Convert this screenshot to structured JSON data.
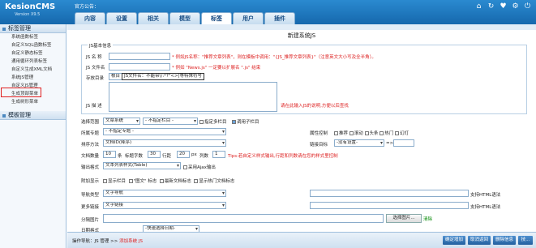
{
  "app": {
    "logo": "KesionCMS",
    "version": "Version X9.5",
    "notice": "官方公告："
  },
  "tabs": [
    {
      "label": "内容"
    },
    {
      "label": "设置"
    },
    {
      "label": "相关"
    },
    {
      "label": "模型"
    },
    {
      "label": "标签"
    },
    {
      "label": "用户"
    },
    {
      "label": "插件"
    }
  ],
  "active_tab": "标签",
  "sidebar": {
    "section1": "标签管理",
    "items": [
      "系统函数标签",
      "自定义SQL函数标签",
      "自定义静态标签",
      "通用循环列表标签",
      "自定义生成XML文档",
      "系统JS管理",
      "自定义JS管理",
      "生成顶部菜单",
      "生成树形菜单"
    ],
    "highlighted": "系统JS管理",
    "section2": "模板管理"
  },
  "page": {
    "title": "新建系统JS",
    "legend": "JS基本信息"
  },
  "form": {
    "js_name_label": "JS 名 称",
    "js_name_hint": "* 例如JS名称：\"推荐文章列表\"，则在模板中调用：\"{JS_推荐文章列表}\"（注意英文大小写及全半角）。",
    "js_file_label": "JS 文件名",
    "js_file_hint": "* 例如 \"News.js\" 一定要以扩展名 \".js\" 结束",
    "dir_label": "存放目录",
    "dir_value": "根目",
    "dir_tooltip": "JS文件名：不能带\\/:*?\"<>|等特殊符号",
    "desc_label": "JS 描 述",
    "desc_hint": "请在此输入JS的说明,方便以后查找",
    "column_label": "选择范围",
    "column_value": "文章系统",
    "column_sub": "- 不指定栏目 -",
    "cb_multi": "指定多栏目",
    "cb_sub": "调用子栏目",
    "special_label": "所属专题",
    "special_value": "- 不指定专题 -",
    "attr_label": "属性控制",
    "attrs": [
      "推荐",
      "滚动",
      "头条",
      "热门",
      "幻灯"
    ],
    "order_label": "排序方法",
    "order_value": "文档ID(降序)",
    "target_label": "链接目标",
    "target_value": "-没有设置-",
    "count_label": "文档数量",
    "count_value": "10",
    "count_unit": "条",
    "title_label": "标题字数",
    "title_value": "30",
    "row_label": "行距",
    "row_value": "20",
    "row_unit": "px",
    "cols_label": "列数",
    "cols_value": "1",
    "tips": "Tips:若自定义样式输出,行距和列数请在您的样式里控制",
    "output_label": "输出格式",
    "output_value": "文本列表样式(Table)",
    "ajax": "采用Ajax输出",
    "extra_label": "附加显示",
    "extras": [
      "显示栏目",
      "\"图文\" 标志",
      "最新文档标志",
      "显示热门文档标志"
    ],
    "nav_label": "导航类型",
    "nav_value": "文字导航",
    "nav_html": "支持HTML语法",
    "more_label": "更多链接",
    "more_value": "文字链接",
    "more_html": "支持HTML语法",
    "sep_label": "分隔图片",
    "pick_btn": "选择图片...",
    "clear": "清除",
    "date_label": "日期格式",
    "date_value": "-快速选择日期-"
  },
  "footer": {
    "nav_label": "操作导航：",
    "nav_path": "JS 管理 >> ",
    "nav_current": "添加系统 JS",
    "btns": [
      "确定增加",
      "取消返回",
      "删除信息",
      "技..."
    ]
  }
}
